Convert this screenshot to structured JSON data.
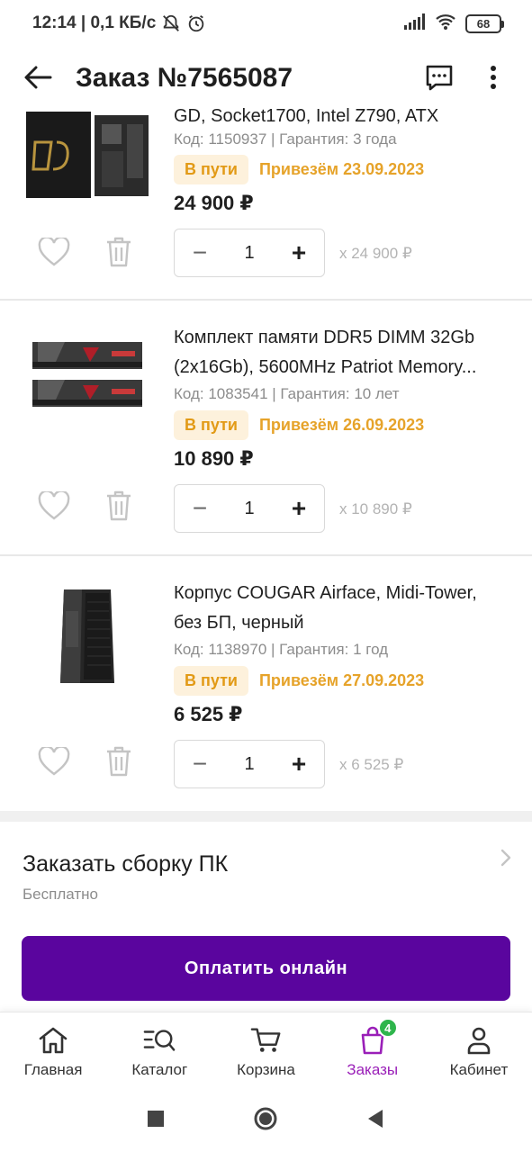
{
  "status_bar": {
    "time_and_speed": "12:14 | 0,1 КБ/с",
    "battery": "68"
  },
  "header": {
    "title": "Заказ №7565087",
    "icons": [
      "arrow-left-icon",
      "chat-icon",
      "more-vertical-icon"
    ]
  },
  "items": [
    {
      "name": "GD, Socket1700, Intel Z790, ATX",
      "code": "Код: 1150937 | Гарантия: 3 года",
      "status": "В пути",
      "delivery": "Привезём 23.09.2023",
      "price": "24 900 ₽",
      "quantity": "1",
      "unit_price": "x 24 900 ₽"
    },
    {
      "name_line1": "Комплект памяти DDR5 DIMM 32Gb",
      "name_line2": "(2x16Gb), 5600MHz Patriot Memory...",
      "code": "Код: 1083541 | Гарантия: 10 лет",
      "status": "В пути",
      "delivery": "Привезём 26.09.2023",
      "price": "10 890 ₽",
      "quantity": "1",
      "unit_price": "x 10 890 ₽"
    },
    {
      "name_line1": "Корпус COUGAR Airface, Midi-Tower,",
      "name_line2": "без БП, черный",
      "code": "Код: 1138970 | Гарантия: 1 год",
      "status": "В пути",
      "delivery": "Привезём 27.09.2023",
      "price": "6 525 ₽",
      "quantity": "1",
      "unit_price": "x 6 525 ₽"
    }
  ],
  "stepper": {
    "minus": "−",
    "plus": "+"
  },
  "assembly": {
    "title": "Заказать сборку ПК",
    "subtitle": "Бесплатно"
  },
  "pay_button": "Оплатить онлайн",
  "bottom_nav": [
    {
      "label": "Главная",
      "icon": "home-icon"
    },
    {
      "label": "Каталог",
      "icon": "catalog-search-icon"
    },
    {
      "label": "Корзина",
      "icon": "cart-icon"
    },
    {
      "label": "Заказы",
      "icon": "orders-bag-icon",
      "badge": "4",
      "active": true
    },
    {
      "label": "Кабинет",
      "icon": "user-icon"
    }
  ],
  "colors": {
    "accent": "#5a059e",
    "active_nav": "#9a1fb8",
    "status_badge_bg": "#fdf1dc",
    "status_text": "#e29a16",
    "badge_green": "#2eb54c"
  }
}
